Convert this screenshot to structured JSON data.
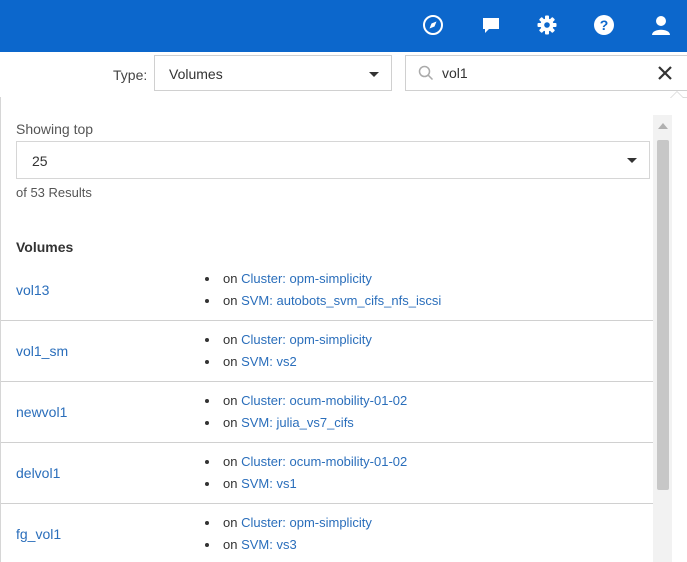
{
  "header": {
    "icons": [
      "compass-icon",
      "chat-icon",
      "gear-icon",
      "help-icon",
      "user-icon"
    ],
    "background_color": "#0c67cc"
  },
  "toolbar": {
    "type_label": "Type:",
    "type_value": "Volumes",
    "search_value": "vol1"
  },
  "results": {
    "showing_label": "Showing top",
    "top_value": "25",
    "count_label": "of 53 Results",
    "section_title": "Volumes",
    "items": [
      {
        "name": "vol13",
        "on1": "on",
        "link1": "Cluster: opm-simplicity",
        "on2": "on",
        "link2": "SVM: autobots_svm_cifs_nfs_iscsi"
      },
      {
        "name": "vol1_sm",
        "on1": "on",
        "link1": "Cluster: opm-simplicity",
        "on2": "on",
        "link2": "SVM: vs2"
      },
      {
        "name": "newvol1",
        "on1": "on",
        "link1": "Cluster: ocum-mobility-01-02",
        "on2": "on",
        "link2": "SVM: julia_vs7_cifs"
      },
      {
        "name": "delvol1",
        "on1": "on",
        "link1": "Cluster: ocum-mobility-01-02",
        "on2": "on",
        "link2": "SVM: vs1"
      },
      {
        "name": "fg_vol1",
        "on1": "on",
        "link1": "Cluster: opm-simplicity",
        "on2": "on",
        "link2": "SVM: vs3"
      }
    ],
    "link_color": "#2a6ebb"
  }
}
